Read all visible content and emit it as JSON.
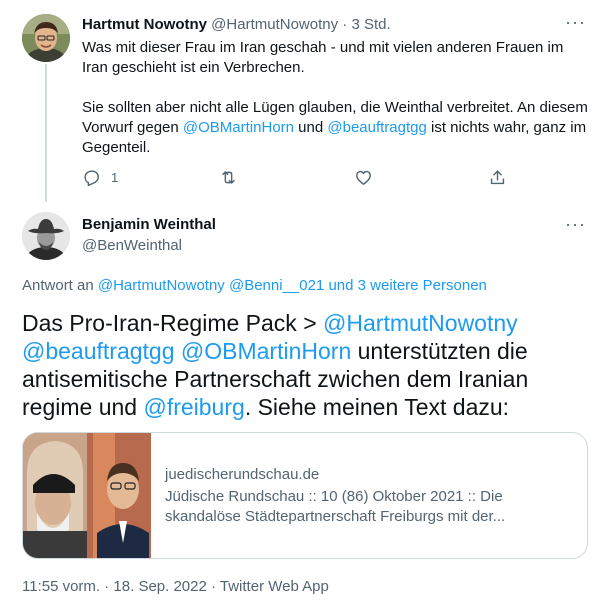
{
  "reply_tweet": {
    "author_name": "Hartmut Nowotny",
    "author_handle": "@HartmutNowotny",
    "separator": "·",
    "time": "3 Std.",
    "more_label": "···",
    "paragraph1": "Was mit dieser Frau im Iran geschah - und mit vielen anderen Frauen im Iran geschieht ist ein Verbrechen.",
    "p2_text1": "Sie sollten aber nicht alle Lügen glauben, die Weinthal verbreitet. An diesem Vorwurf gegen ",
    "p2_mention1": "@OBMartinHorn",
    "p2_text2": " und ",
    "p2_mention2": "@beauftragtgg",
    "p2_text3": " ist nichts wahr, ganz im Gegenteil.",
    "reply_count": "1",
    "icons": [
      "reply-icon",
      "retweet-icon",
      "like-icon",
      "share-icon"
    ]
  },
  "main_tweet": {
    "author_name": "Benjamin Weinthal",
    "author_handle": "@BenWeinthal",
    "more_label": "···",
    "reply_prefix": "Antwort an ",
    "reply_targets": "@HartmutNowotny @Benni__021 und 3 weitere Personen",
    "text1": "Das Pro-Iran-Regime Pack > ",
    "mention1": "@HartmutNowotny",
    "space1": " ",
    "mention2": "@beauftragtgg",
    "space2": " ",
    "mention3": "@OBMartinHorn",
    "text2": " unterstützten die antisemitische Partnerschaft zwichen dem Iranian regime und ",
    "mention4": "@freiburg",
    "text3": ". Siehe meinen Text dazu:",
    "card": {
      "domain": "juedischerundschau.de",
      "title": "Jüdische Rundschau :: 10 (86) Oktober 2021 :: Die skandalöse Städtepartnerschaft Freiburgs mit der..."
    },
    "timestamp": "11:55 vorm. · 18. Sep. 2022 · Twitter Web App"
  },
  "colors": {
    "accent": "#1d9bf0",
    "text": "#0f1419",
    "muted": "#536471",
    "border": "#cfd9de"
  }
}
